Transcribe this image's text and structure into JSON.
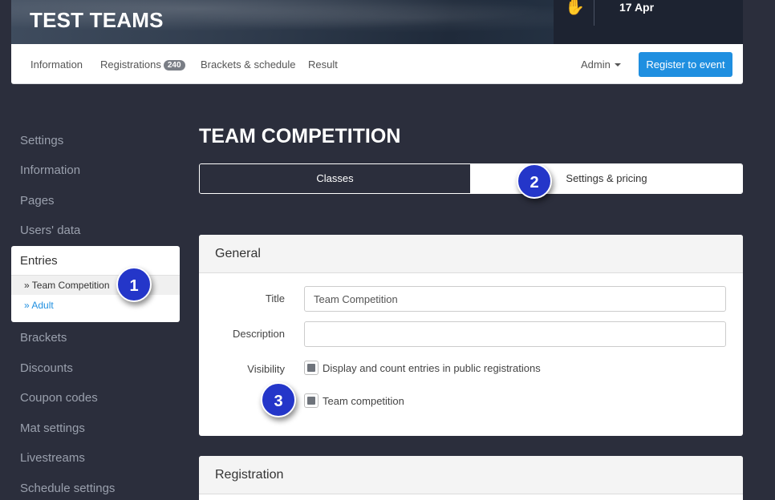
{
  "banner": {
    "title": "TEST TEAMS",
    "date": "17 Apr",
    "logo_icon": "handshake-icon"
  },
  "nav": {
    "items": [
      {
        "label": "Information"
      },
      {
        "label": "Registrations",
        "badge": "240"
      },
      {
        "label": "Brackets & schedule"
      },
      {
        "label": "Result"
      }
    ],
    "admin_label": "Admin",
    "register_label": "Register to event"
  },
  "sidebar": {
    "items_top": [
      "Settings",
      "Information",
      "Pages",
      "Users' data"
    ],
    "entries": {
      "title": "Entries",
      "sub_active": "» Team Competition",
      "sub_other": "» Adult"
    },
    "items_bottom": [
      "Brackets",
      "Discounts",
      "Coupon codes",
      "Mat settings",
      "Livestreams",
      "Schedule settings"
    ]
  },
  "main": {
    "title": "TEAM COMPETITION",
    "tabs": [
      {
        "label": "Classes"
      },
      {
        "label": "Settings & pricing"
      }
    ],
    "general": {
      "heading": "General",
      "title_label": "Title",
      "title_value": "Team Competition",
      "description_label": "Description",
      "description_value": "",
      "visibility_label": "Visibility",
      "checkbox_public": "Display and count entries in public registrations",
      "checkbox_team": "Team competition"
    },
    "registration": {
      "heading": "Registration"
    }
  },
  "callouts": [
    "1",
    "2",
    "3"
  ],
  "colors": {
    "accent": "#1f8fe0",
    "background": "#2b2e3c",
    "callout": "#2436c9"
  }
}
